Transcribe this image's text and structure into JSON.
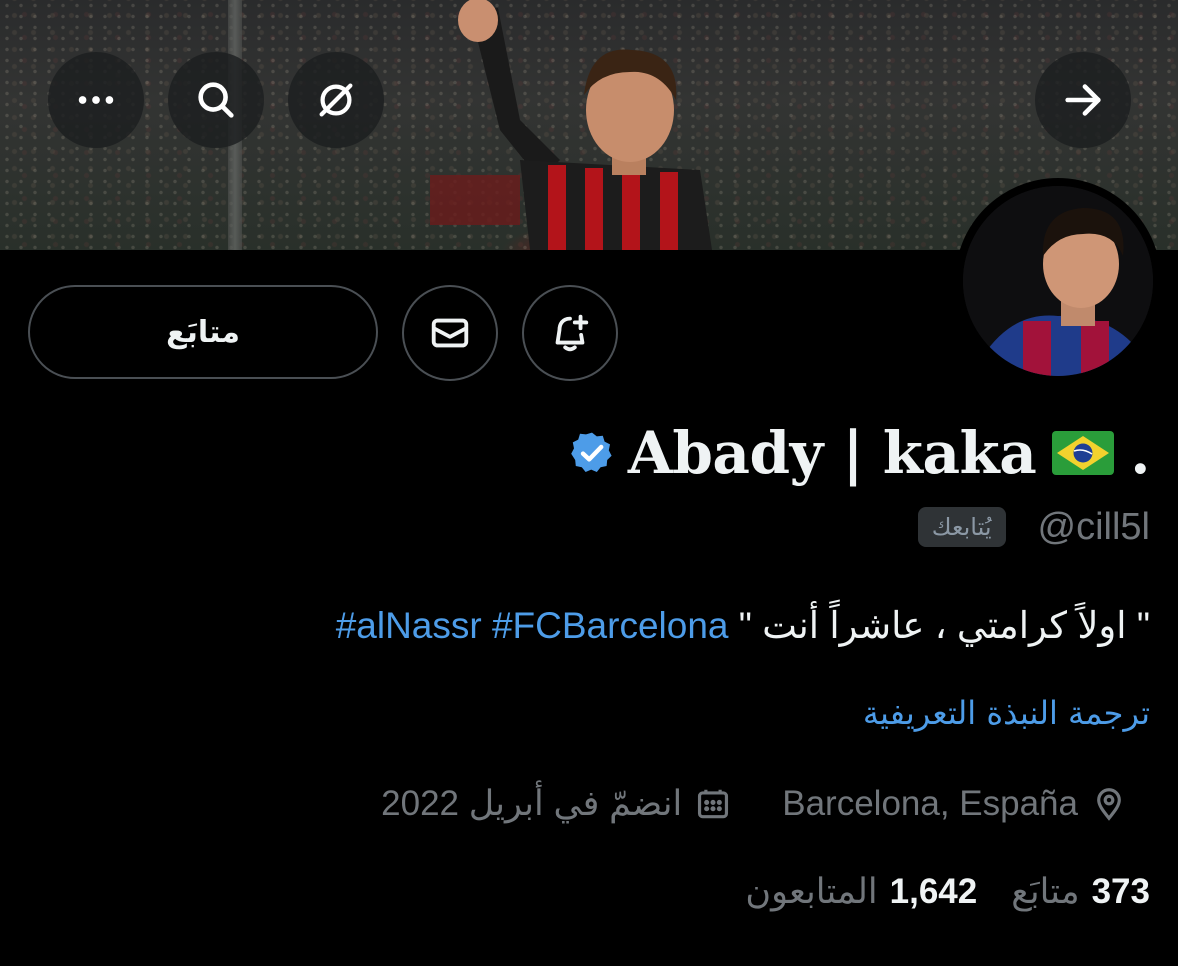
{
  "header": {
    "back_icon": "arrow-right-icon",
    "more_icon": "more-horizontal-icon",
    "search_icon": "search-icon",
    "grok_icon": "slash-circle-icon"
  },
  "profile": {
    "display_name": "Abady | kaka",
    "name_suffix": ".",
    "flag_emoji": "🇧🇷",
    "handle": "@cill5l",
    "follows_you_badge": "يُتابعك",
    "verified_color": "#4d9ce8",
    "bio_text": "\" اولاً كرامتي ، عاشراً أنت \"",
    "bio_hashtags": [
      "#FCBarcelona",
      "#alNassr"
    ],
    "translate_link": "ترجمة النبذة التعريفية",
    "location": "Barcelona, España",
    "joined": "انضمّ في أبريل 2022"
  },
  "actions": {
    "follow_label": "متابَع",
    "message_icon": "envelope-icon",
    "notify_icon": "bell-plus-icon"
  },
  "stats": {
    "following_count": "373",
    "following_label": "متابَع",
    "followers_count": "1,642",
    "followers_label": "المتابعون"
  },
  "colors": {
    "background": "#000000",
    "link": "#4d9ce8",
    "muted": "#71767b"
  }
}
